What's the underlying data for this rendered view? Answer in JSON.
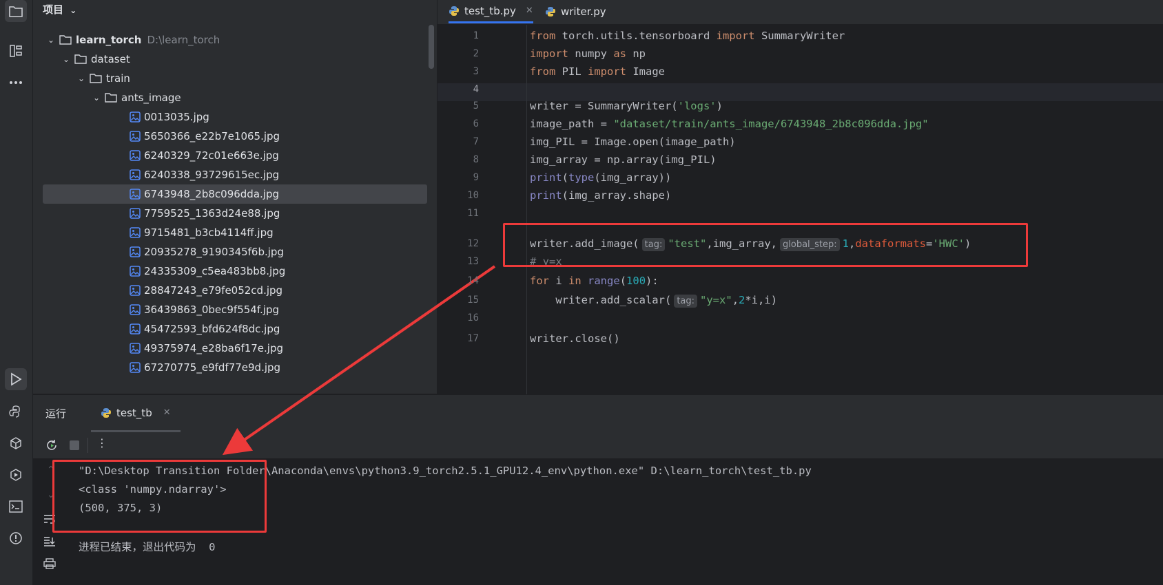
{
  "project_panel": {
    "title": "项目",
    "tree": [
      {
        "label": "learn_torch",
        "hint": "D:\\learn_torch"
      },
      {
        "label": "dataset"
      },
      {
        "label": "train"
      },
      {
        "label": "ants_image"
      }
    ],
    "files": [
      "0013035.jpg",
      "5650366_e22b7e1065.jpg",
      "6240329_72c01e663e.jpg",
      "6240338_93729615ec.jpg",
      "6743948_2b8c096dda.jpg",
      "7759525_1363d24e88.jpg",
      "9715481_b3cb4114ff.jpg",
      "20935278_9190345f6b.jpg",
      "24335309_c5ea483bb8.jpg",
      "28847243_e79fe052cd.jpg",
      "36439863_0bec9f554f.jpg",
      "45472593_bfd624f8dc.jpg",
      "49375974_e28ba6f17e.jpg",
      "67270775_e9fdf77e9d.jpg"
    ],
    "selected_file": "6743948_2b8c096dda.jpg"
  },
  "tabs": [
    {
      "label": "test_tb.py",
      "active": true
    },
    {
      "label": "writer.py",
      "active": false
    }
  ],
  "editor": {
    "line_numbers": [
      "1",
      "2",
      "3",
      "4",
      "5",
      "6",
      "7",
      "8",
      "9",
      "10",
      "11",
      "12",
      "13",
      "14",
      "15",
      "16",
      "17"
    ],
    "lines": {
      "l1": {
        "kw1": "from",
        "t1": " torch.utils.tensorboard ",
        "kw2": "import",
        "t2": " SummaryWriter"
      },
      "l2": {
        "kw1": "import",
        "t1": " numpy ",
        "kw2": "as",
        "t2": " np"
      },
      "l3": {
        "kw1": "from",
        "t1": " PIL ",
        "kw2": "import",
        "t2": " Image"
      },
      "l5": {
        "t1": "writer = SummaryWriter(",
        "s1": "'logs'",
        "t2": ")"
      },
      "l6": {
        "t1": "image_path = ",
        "s1": "\"dataset/train/ants_image/6743948_2b8c096dda.jpg\""
      },
      "l7": {
        "t1": "img_PIL = Image.open(image_path)"
      },
      "l8": {
        "t1": "img_array = np.array(img_PIL)"
      },
      "l9": {
        "b1": "print",
        "t1": "(",
        "b2": "type",
        "t2": "(img_array))"
      },
      "l10": {
        "b1": "print",
        "t1": "(img_array.shape)"
      },
      "l12": {
        "t1": "writer.add_image(",
        "h1": "tag:",
        "s1": "\"test\"",
        "t2": ",img_array,",
        "h2": "global_step:",
        "n1": "1",
        "t3": ",",
        "p1": "dataformats",
        "t4": "=",
        "s2": "'HWC'",
        "t5": ")"
      },
      "l13": {
        "c1": "# y=x"
      },
      "l14": {
        "kw1": "for",
        "t1": " i ",
        "kw2": "in",
        "t2": " ",
        "b1": "range",
        "t3": "(",
        "n1": "100",
        "t4": "):"
      },
      "l15": {
        "t1": "    writer.add_scalar(",
        "h1": "tag:",
        "s1": "\"y=x\"",
        "t2": ",",
        "n1": "2",
        "t3": "*i,i)"
      },
      "l17": {
        "t1": "writer.close()"
      }
    }
  },
  "run": {
    "tab_label": "运行",
    "config_label": "test_tb",
    "output": [
      "\"D:\\Desktop Transition Folder\\Anaconda\\envs\\python3.9_torch2.5.1_GPU12.4_env\\python.exe\" D:\\learn_torch\\test_tb.py",
      "<class 'numpy.ndarray'>",
      "(500, 375, 3)",
      "",
      "进程已结束，退出代码为  0"
    ]
  },
  "colors": {
    "annotation_red": "#ec3a3a",
    "keyword": "#cf8e6d",
    "string": "#6aab73",
    "number": "#2aacb8",
    "builtin": "#8888c6"
  }
}
